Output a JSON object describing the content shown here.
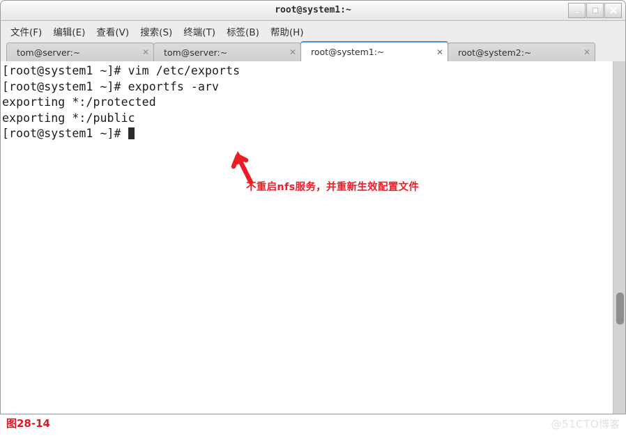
{
  "window": {
    "title": "root@system1:~",
    "controls": [
      {
        "name": "minimize-button",
        "glyph": "_"
      },
      {
        "name": "maximize-button",
        "glyph": "□"
      },
      {
        "name": "close-button",
        "glyph": "✕"
      }
    ]
  },
  "menubar": {
    "items": [
      {
        "label": "文件(F)"
      },
      {
        "label": "编辑(E)"
      },
      {
        "label": "查看(V)"
      },
      {
        "label": "搜索(S)"
      },
      {
        "label": "终端(T)"
      },
      {
        "label": "标签(B)"
      },
      {
        "label": "帮助(H)"
      }
    ]
  },
  "tabs": {
    "close_glyph": "✕",
    "items": [
      {
        "label": "tom@server:~",
        "active": false
      },
      {
        "label": "tom@server:~",
        "active": false
      },
      {
        "label": "root@system1:~",
        "active": true
      },
      {
        "label": "root@system2:~",
        "active": false
      }
    ]
  },
  "terminal": {
    "lines": [
      "[root@system1 ~]# vim /etc/exports",
      "[root@system1 ~]# exportfs -arv",
      "exporting *:/protected",
      "exporting *:/public"
    ],
    "prompt_last": "[root@system1 ~]# "
  },
  "annotation": {
    "text": "不重启nfs服务，并重新生效配置文件",
    "color": "#ef1d26",
    "arrow_name": "red-arrow-pointing-to-command"
  },
  "footer": {
    "figure_label": "图28-14",
    "watermark": "@51CTO博客"
  }
}
